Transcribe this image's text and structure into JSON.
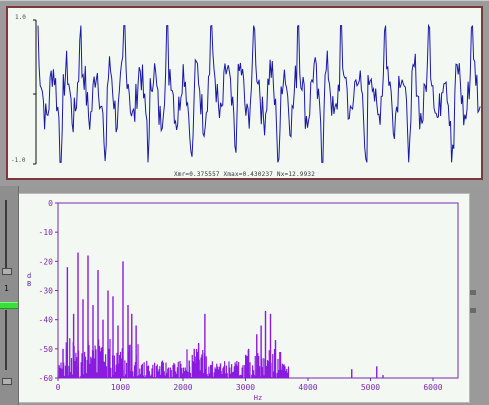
{
  "waveform": {
    "ymax_label": "1.0",
    "ymin_label": "-1.0",
    "stats": "Xmr=0.375557  Xmax=0.430237  Nx=12.9932",
    "color": "#1a1aa6"
  },
  "spectrum": {
    "ylabel": "d\nB",
    "xlabel": "Hz",
    "y_ticks": [
      "0",
      "-10",
      "-20",
      "-30",
      "-40",
      "-50",
      "-60"
    ],
    "x_ticks": [
      "0",
      "1000",
      "2000",
      "3000",
      "4000",
      "5000",
      "6000"
    ],
    "color": "#8a1ae0",
    "frame_color": "#7a2ab0"
  },
  "left_panel": {
    "channel_label": "1"
  },
  "chart_data": {
    "type": "bar",
    "title": "",
    "xlabel": "Hz",
    "ylabel": "dB",
    "xlim": [
      0,
      6400
    ],
    "ylim": [
      -60,
      0
    ],
    "peaks_hz": [
      80,
      150,
      250,
      320,
      400,
      480,
      560,
      640,
      720,
      800,
      880,
      960,
      1040,
      1120,
      1180,
      1250,
      2100,
      2180,
      2250,
      2350,
      2600,
      3050,
      3180,
      3250,
      3320,
      3400,
      3480,
      3560,
      4700,
      5100,
      5200
    ],
    "peaks_db": [
      -50,
      -22,
      -38,
      -17,
      -33,
      -18,
      -35,
      -23,
      -40,
      -30,
      -32,
      -42,
      -20,
      -35,
      -38,
      -42,
      -54,
      -50,
      -48,
      -38,
      -55,
      -50,
      -45,
      -42,
      -37,
      -38,
      -47,
      -56,
      -57,
      -56,
      -59
    ]
  }
}
